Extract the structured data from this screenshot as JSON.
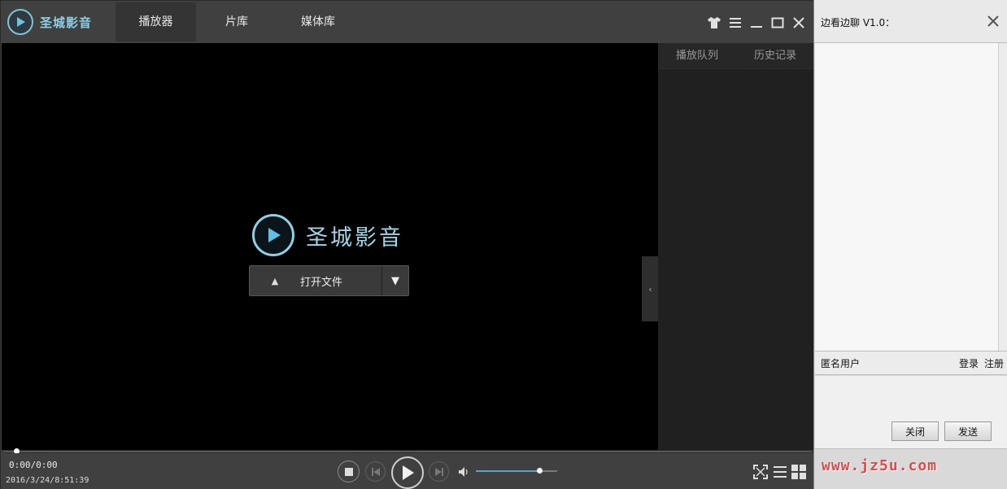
{
  "app": {
    "brand_name": "圣城影音",
    "tabs": [
      {
        "label": "播放器",
        "active": true
      },
      {
        "label": "片库",
        "active": false
      },
      {
        "label": "媒体库",
        "active": false
      }
    ],
    "window_controls": [
      "skin-icon",
      "menu-icon",
      "minimize-icon",
      "maximize-icon",
      "close-icon"
    ]
  },
  "video": {
    "splash_brand": "圣城影音",
    "open_button_label": "打开文件"
  },
  "side_panel": {
    "tabs": [
      "播放队列",
      "历史记录"
    ]
  },
  "playback": {
    "time": "0:00/0:00",
    "clock": "2016/3/24/8:51:39",
    "progress_fraction": 0.0,
    "volume_fraction": 0.78
  },
  "chat": {
    "title": "边看边聊 V1.0：",
    "user_name": "匿名用户",
    "login_label": "登录",
    "register_label": "注册",
    "close_button_label": "关闭",
    "send_button_label": "发送"
  },
  "watermark": "www.jz5u.com",
  "colors": {
    "accent": "#4aa8d8",
    "brand": "#8fd0e6",
    "watermark": "#d94a4a"
  }
}
